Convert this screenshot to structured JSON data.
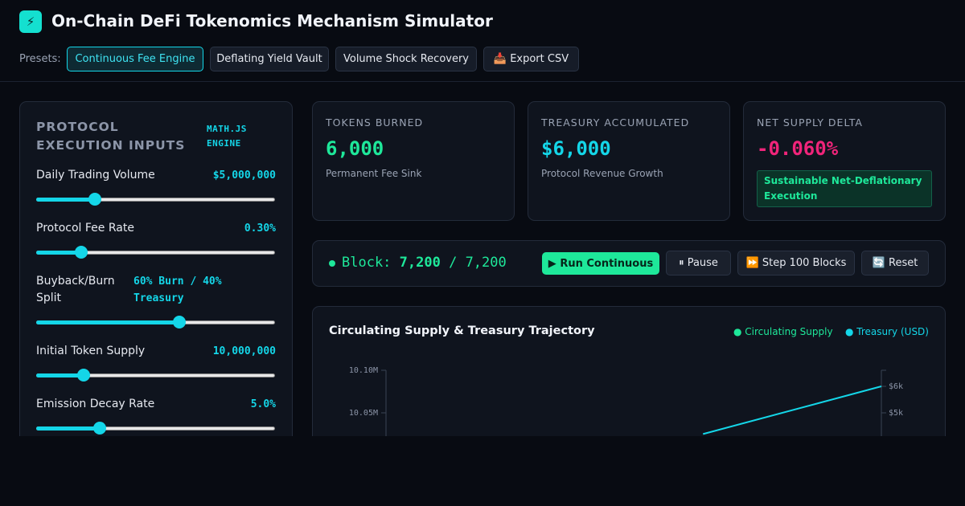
{
  "header": {
    "logo_glyph": "⚡",
    "title": "On-Chain DeFi Tokenomics Mechanism Simulator",
    "presets_label": "Presets:",
    "presets": [
      {
        "label": "Continuous Fee Engine",
        "active": true
      },
      {
        "label": "Deflating Yield Vault",
        "active": false
      },
      {
        "label": "Volume Shock Recovery",
        "active": false
      },
      {
        "label": "📥 Export CSV",
        "active": false
      }
    ]
  },
  "inputs": {
    "title": "PROTOCOL EXECUTION INPUTS",
    "engine_tag_line1": "MATH.JS",
    "engine_tag_line2": "ENGINE",
    "controls": [
      {
        "label": "Daily Trading Volume",
        "value": "$5,000,000",
        "position": 0.245
      },
      {
        "label": "Protocol Fee Rate",
        "value": "0.30%",
        "position": 0.19
      },
      {
        "label_line1": "Buyback/Burn",
        "label_line2": "Split",
        "value_line1": "60% Burn / 40%",
        "value_line2": "Treasury",
        "position": 0.6
      },
      {
        "label": "Initial Token Supply",
        "value": "10,000,000",
        "position": 0.2
      },
      {
        "label": "Emission Decay Rate",
        "value": "5.0%",
        "position": 0.265
      }
    ]
  },
  "stats": {
    "burned": {
      "label": "TOKENS BURNED",
      "value": "6,000",
      "sub": "Permanent Fee Sink"
    },
    "treasury": {
      "label": "TREASURY ACCUMULATED",
      "value": "$6,000",
      "sub": "Protocol Revenue Growth"
    },
    "delta": {
      "label": "NET SUPPLY DELTA",
      "value": "-0.060%",
      "badge_line1": "Sustainable Net-Deflationary",
      "badge_line2": "Execution"
    }
  },
  "block": {
    "prefix": "Block: ",
    "current": "7,200",
    "separator": " / ",
    "total": "7,200",
    "run_label": "▶ Run Continuous",
    "pause_label": "⏸ Pause",
    "step_label": "⏩ Step 100 Blocks",
    "reset_label": "🔄 Reset"
  },
  "chart_title": "Circulating Supply & Treasury Trajectory",
  "chart_data": {
    "type": "line",
    "legend": [
      "Circulating Supply",
      "Treasury (USD)"
    ],
    "left_axis": {
      "ticks": [
        "10.10M",
        "10.05M"
      ]
    },
    "right_axis": {
      "ticks": [
        "$6k",
        "$5k"
      ]
    },
    "series": [
      {
        "name": "Treasury (USD)",
        "color": "#14d6e8",
        "axis": "right",
        "points": [
          [
            0.64,
            4200
          ],
          [
            1.0,
            6000
          ]
        ]
      }
    ],
    "colors": {
      "supply": "#1ee89a",
      "treasury": "#14d6e8"
    }
  }
}
